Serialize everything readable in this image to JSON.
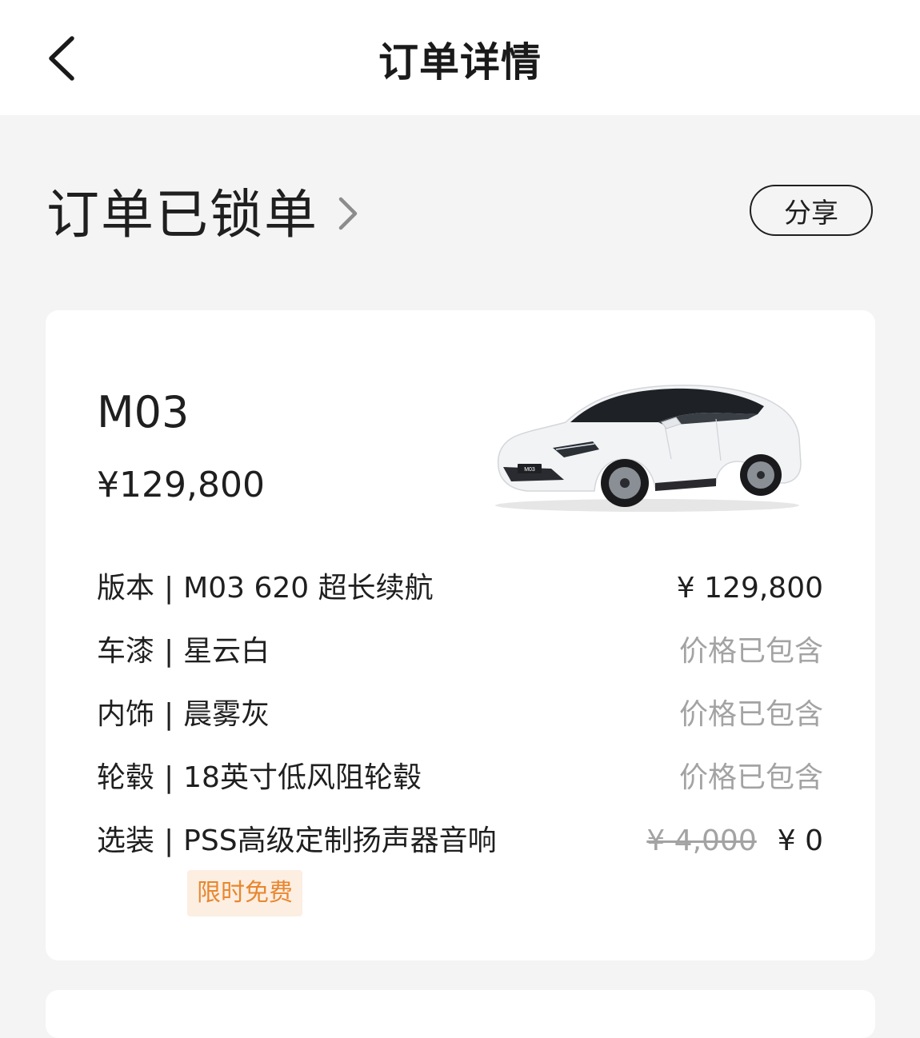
{
  "header": {
    "title": "订单详情",
    "back_icon": "chevron-left-icon"
  },
  "status": {
    "title": "订单已锁单",
    "chevron_icon": "chevron-right-icon",
    "share_label": "分享"
  },
  "vehicle": {
    "model": "M03",
    "price": "¥129,800",
    "image": "white-sedan-car-image",
    "plate_text": "M03"
  },
  "specs": [
    {
      "label": "版本",
      "separator": "|",
      "value": "M03 620 超长续航",
      "price": "¥ 129,800"
    },
    {
      "label": "车漆",
      "separator": "|",
      "value": "星云白",
      "price": "价格已包含"
    },
    {
      "label": "内饰",
      "separator": "|",
      "value": "晨雾灰",
      "price": "价格已包含"
    },
    {
      "label": "轮毂",
      "separator": "|",
      "value": "18英寸低风阻轮毂",
      "price": "价格已包含"
    },
    {
      "label": "选装",
      "separator": "|",
      "value": "PSS高级定制扬声器音响",
      "original_price": "¥ 4,000",
      "price": "¥ 0"
    }
  ],
  "promo": {
    "label": "限时免费"
  },
  "colors": {
    "background": "#f4f4f4",
    "card": "#ffffff",
    "text_primary": "#1f1f1f",
    "text_muted": "#a3a3a3",
    "promo_bg": "#fdeee2",
    "promo_text": "#e8872e"
  }
}
